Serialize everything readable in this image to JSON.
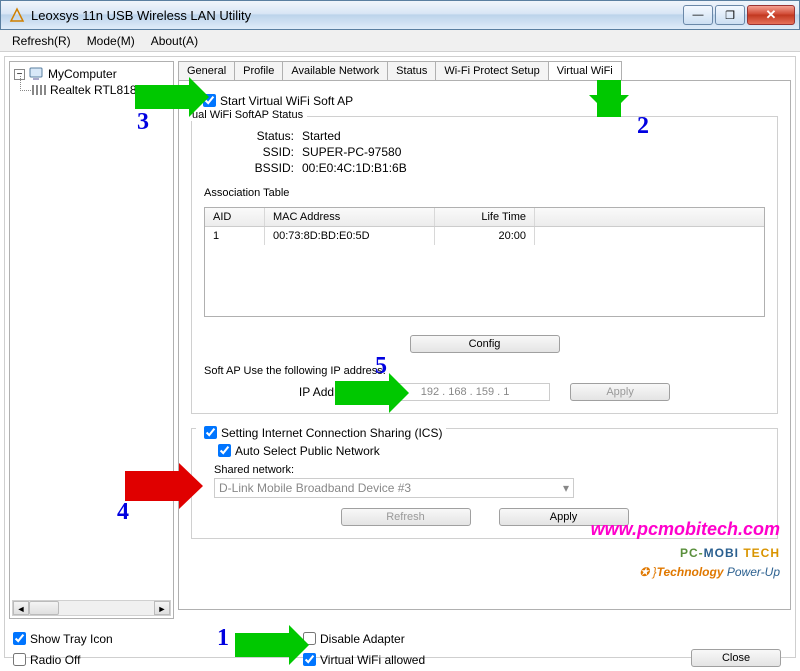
{
  "window": {
    "title": "Leoxsys 11n USB Wireless LAN Utility",
    "minimize": "—",
    "maximize": "❐",
    "close": "✕"
  },
  "menu": {
    "refresh": "Refresh(R)",
    "mode": "Mode(M)",
    "about": "About(A)"
  },
  "tree": {
    "root": "MyComputer",
    "adapter": "Realtek RTL818"
  },
  "tabs": {
    "general": "General",
    "profile": "Profile",
    "available": "Available Network",
    "status": "Status",
    "wps": "Wi-Fi Protect Setup",
    "virtual": "Virtual WiFi"
  },
  "vwifi": {
    "start_chk": "Start Virtual WiFi Soft AP",
    "group_title": "ual WiFi SoftAP Status",
    "status_lbl": "Status:",
    "status_val": "Started",
    "ssid_lbl": "SSID:",
    "ssid_val": "SUPER-PC-97580",
    "bssid_lbl": "BSSID:",
    "bssid_val": "00:E0:4C:1D:B1:6B",
    "assoc_title": "Association Table",
    "col_aid": "AID",
    "col_mac": "MAC Address",
    "col_life": "Life Time",
    "row_aid": "1",
    "row_mac": "00:73:8D:BD:E0:5D",
    "row_life": "20:00",
    "config_btn": "Config",
    "ip_title": "Soft AP Use the following IP address:",
    "ip_lbl": "IP Address:",
    "ip_val": "192 . 168 . 159 . 1",
    "apply_btn": "Apply",
    "ics_chk": "Setting Internet Connection Sharing (ICS)",
    "auto_chk": "Auto Select Public Network",
    "shared_lbl": "Shared network:",
    "shared_val": "D-Link Mobile Broadband Device #3",
    "refresh_btn": "Refresh",
    "apply2_btn": "Apply"
  },
  "bottom": {
    "tray": "Show Tray Icon",
    "radio": "Radio Off",
    "disable": "Disable Adapter",
    "allowed": "Virtual WiFi allowed",
    "close": "Close"
  },
  "annotations": {
    "n1": "1",
    "n2": "2",
    "n3": "3",
    "n4": "4",
    "n5": "5"
  },
  "watermark": {
    "url": "www.pcmobitech.com",
    "pc": "PC-",
    "mobi": "MOBI ",
    "tech": "TECH",
    "tag1": "Technology ",
    "tag2": "Power-Up"
  }
}
